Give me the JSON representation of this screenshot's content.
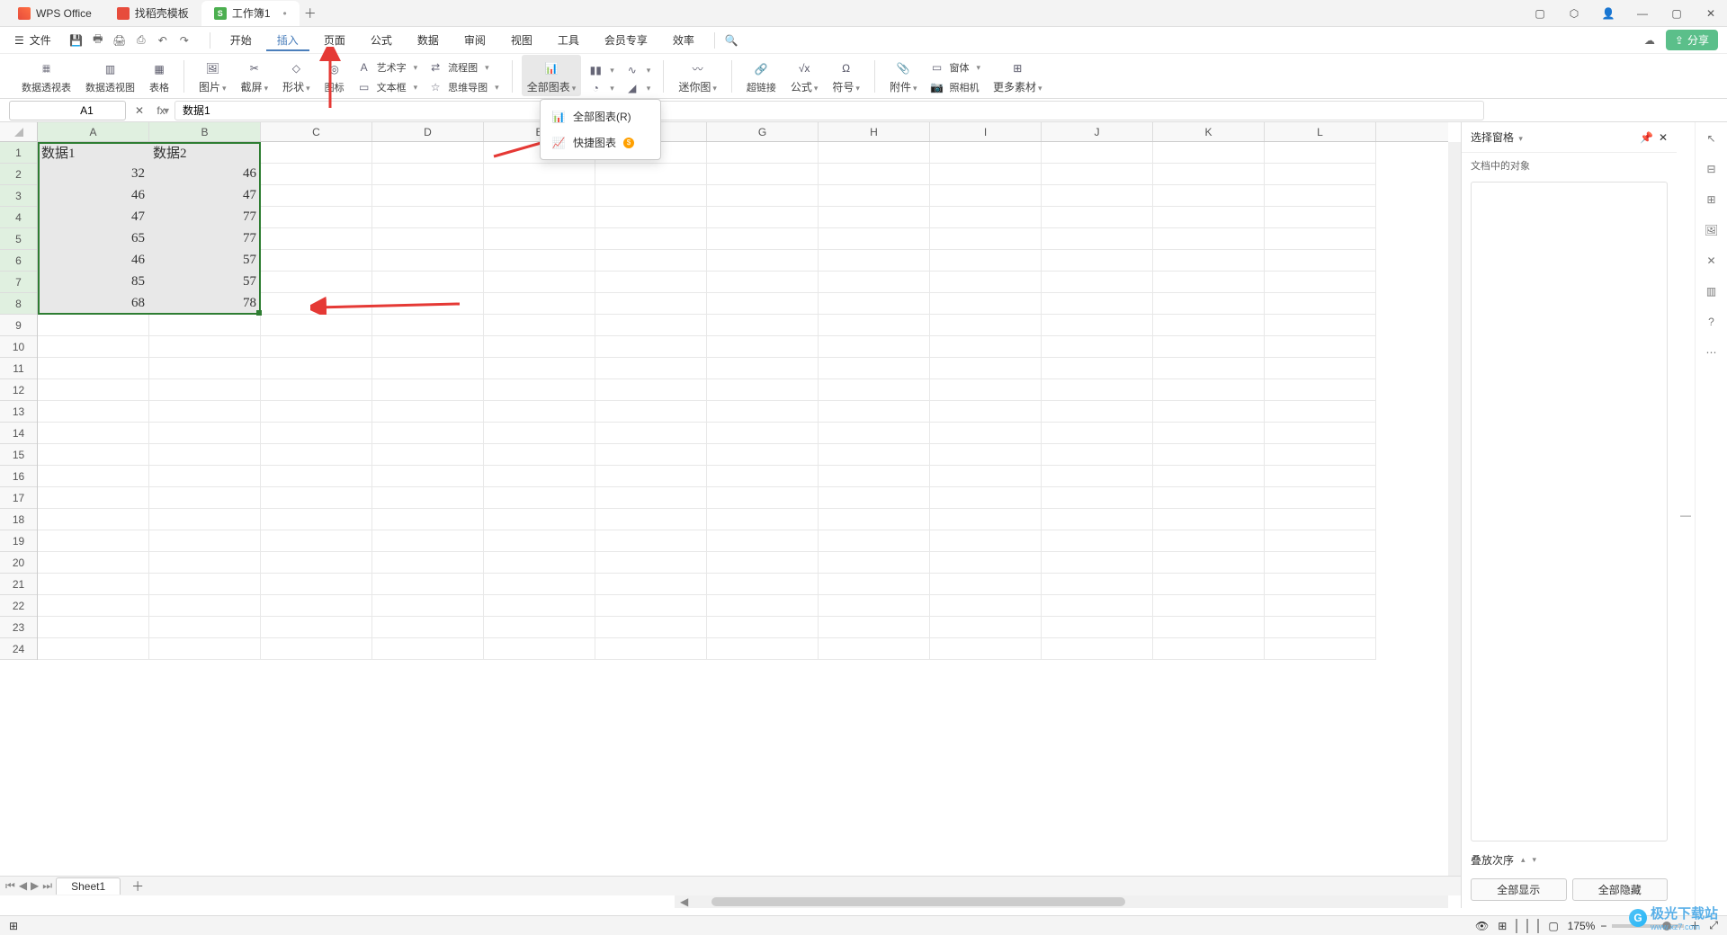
{
  "titlebar": {
    "tabs": [
      {
        "label": "WPS Office",
        "icon": "wps"
      },
      {
        "label": "找稻壳模板",
        "icon": "doc"
      },
      {
        "label": "工作簿1",
        "icon": "sheet",
        "iconText": "S",
        "active": true
      }
    ]
  },
  "menubar": {
    "file": "文件",
    "items": [
      "开始",
      "插入",
      "页面",
      "公式",
      "数据",
      "审阅",
      "视图",
      "工具",
      "会员专享",
      "效率"
    ],
    "activeIndex": 1,
    "share": "分享"
  },
  "ribbon": {
    "g1": [
      {
        "label": "数据透视表"
      },
      {
        "label": "数据透视图"
      },
      {
        "label": "表格"
      }
    ],
    "g2": [
      {
        "label": "图片",
        "caret": true
      },
      {
        "label": "截屏",
        "caret": true
      },
      {
        "label": "形状",
        "caret": true
      },
      {
        "label": "图标"
      }
    ],
    "g2rows": [
      {
        "label": "艺术字",
        "caret": true
      },
      {
        "label": "文本框",
        "caret": true
      },
      {
        "label": "流程图",
        "caret": true
      },
      {
        "label": "思维导图",
        "caret": true
      }
    ],
    "g3": [
      {
        "label": "全部图表",
        "caret": true,
        "highlighted": true
      }
    ],
    "g4": [
      {
        "label": "迷你图",
        "caret": true
      }
    ],
    "g5": [
      {
        "label": "超链接"
      },
      {
        "label": "公式",
        "caret": true
      },
      {
        "label": "符号",
        "caret": true
      }
    ],
    "g6": [
      {
        "label": "附件",
        "caret": true
      },
      {
        "label": "照相机"
      },
      {
        "label": "更多素材",
        "caret": true
      }
    ],
    "g6top": {
      "label": "窗体",
      "caret": true
    }
  },
  "formulabar": {
    "name": "A1",
    "fx": "fx",
    "value": "数据1"
  },
  "grid": {
    "cols": [
      "A",
      "B",
      "C",
      "D",
      "E",
      "F",
      "G",
      "H",
      "I",
      "J",
      "K",
      "L"
    ],
    "rowsShown": 24,
    "headers": [
      "数据1",
      "数据2"
    ],
    "data": [
      [
        32,
        46
      ],
      [
        46,
        47
      ],
      [
        47,
        77
      ],
      [
        65,
        77
      ],
      [
        46,
        57
      ],
      [
        85,
        57
      ],
      [
        68,
        78
      ]
    ]
  },
  "dropdown": {
    "items": [
      {
        "label": "全部图表(R)"
      },
      {
        "label": "快捷图表",
        "badge": "$"
      }
    ]
  },
  "sidepane": {
    "title": "选择窗格",
    "sub": "文档中的对象",
    "footer": "叠放次序",
    "btn1": "全部显示",
    "btn2": "全部隐藏"
  },
  "sheetbar": {
    "sheet": "Sheet1"
  },
  "statusbar": {
    "zoom": "175%"
  },
  "watermark": {
    "text1": "极光下载站",
    "text2": "www.xz7.com"
  }
}
